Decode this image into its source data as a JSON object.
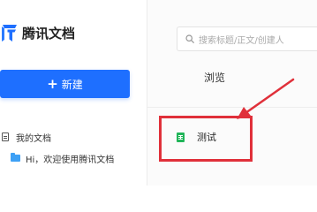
{
  "brand": {
    "name": "腾讯文档",
    "logo_icon": "tencent-docs-logo-icon",
    "color": "#1e6fff"
  },
  "sidebar": {
    "new_button": {
      "icon": "plus-icon",
      "plus": "+",
      "label": "新建",
      "color": "#1e6fff"
    },
    "nav": [
      {
        "icon": "document-icon",
        "label": "我的文档"
      },
      {
        "icon": "folder-icon",
        "label": "Hi，欢迎使用腾讯文档"
      }
    ]
  },
  "search": {
    "icon": "search-icon",
    "placeholder": "搜索标题/正文/创建人"
  },
  "main": {
    "section_title": "浏览",
    "files": [
      {
        "icon": "sheet-icon",
        "name": "测试",
        "icon_color": "#21b559"
      }
    ]
  },
  "annotation": {
    "color": "#e0303a"
  }
}
